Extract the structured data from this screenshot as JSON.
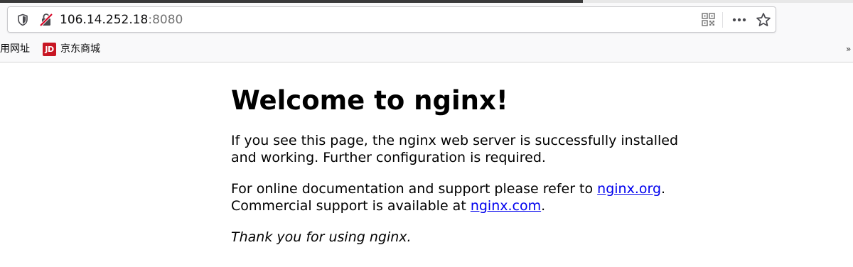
{
  "browser": {
    "url_host": "106.14.252.18",
    "url_port": ":8080",
    "accent_color": "#0c0c0d"
  },
  "bookmarks": {
    "partial_label": "用网址",
    "items": [
      {
        "label": "京东商城",
        "icon": "jd-icon",
        "icon_text": "JD",
        "icon_color": "#c81623"
      }
    ],
    "overflow": "»"
  },
  "page": {
    "heading": "Welcome to nginx!",
    "para1": "If you see this page, the nginx web server is successfully installed and working. Further configuration is required.",
    "para2_prefix": "For online documentation and support please refer to ",
    "link1": "nginx.org",
    "para2_mid": ".",
    "para2_line2_prefix": "Commercial support is available at ",
    "link2": "nginx.com",
    "para2_suffix": ".",
    "thanks": "Thank you for using nginx.",
    "link_color": "#0000ee"
  }
}
